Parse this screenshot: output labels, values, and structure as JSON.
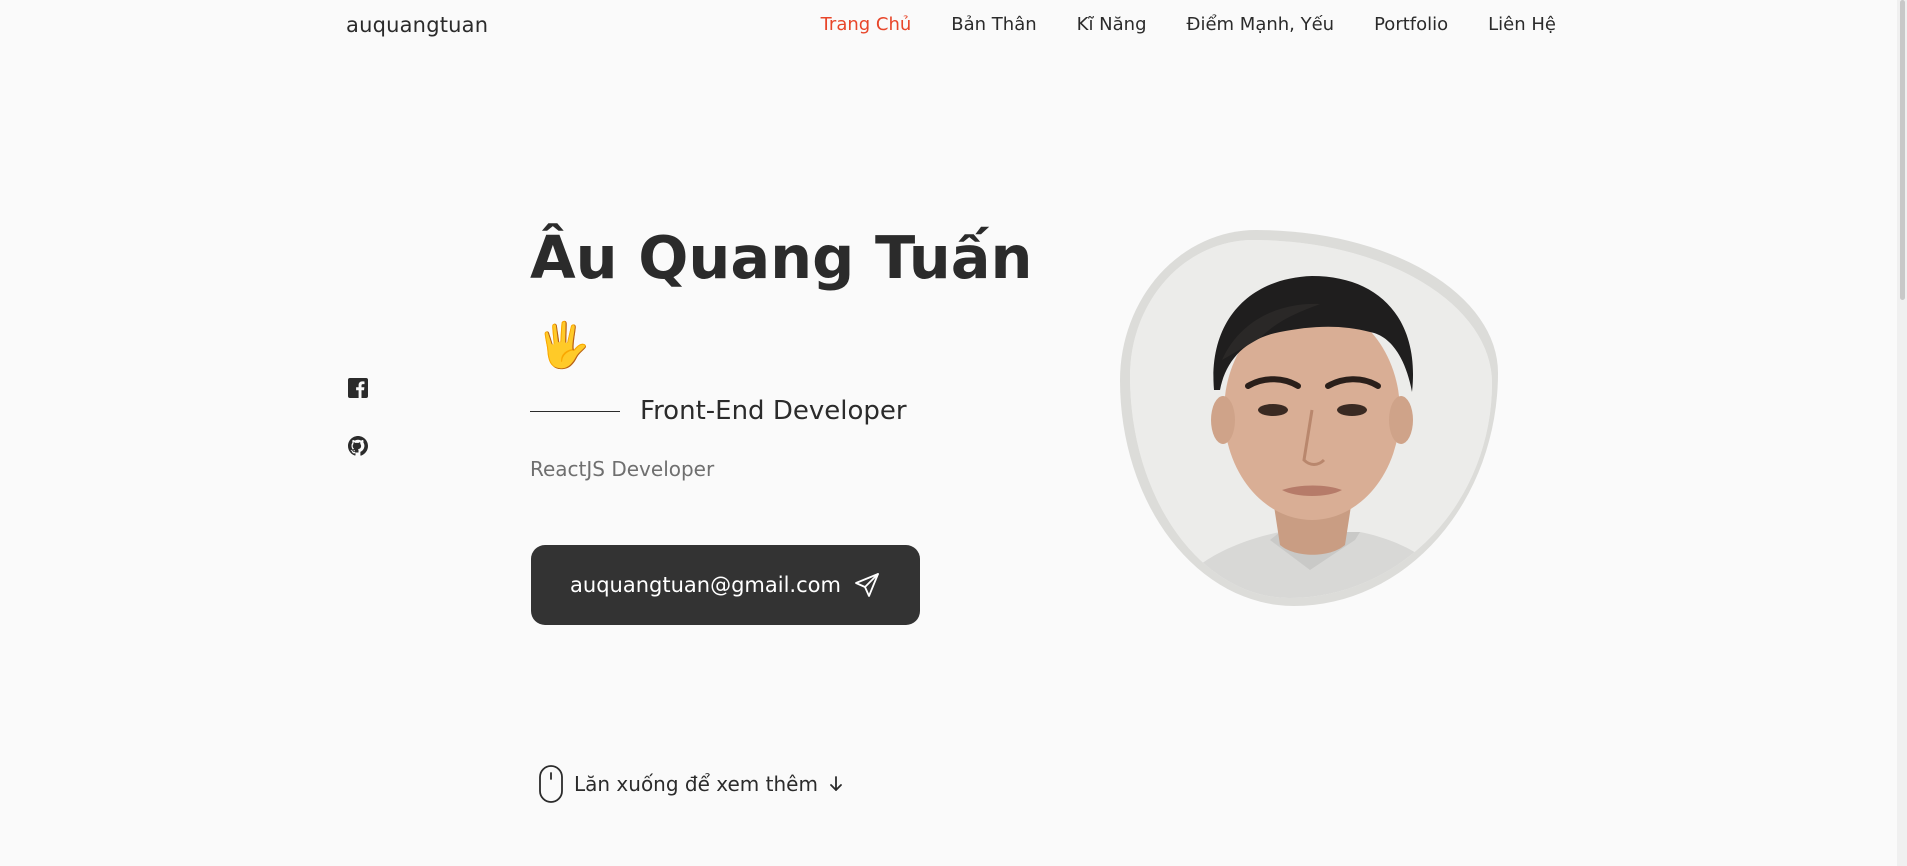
{
  "header": {
    "logo": "auquangtuan",
    "nav": [
      {
        "label": "Trang Chủ",
        "active": true
      },
      {
        "label": "Bản Thân",
        "active": false
      },
      {
        "label": "Kĩ Năng",
        "active": false
      },
      {
        "label": "Điểm Mạnh, Yếu",
        "active": false
      },
      {
        "label": "Portfolio",
        "active": false
      },
      {
        "label": "Liên Hệ",
        "active": false
      }
    ]
  },
  "social": [
    {
      "icon": "facebook-icon"
    },
    {
      "icon": "github-icon"
    }
  ],
  "hero": {
    "name": "Âu Quang Tuấn",
    "wave": "🖐",
    "title": "Front-End Developer",
    "description": "ReactJS Developer",
    "email": "auquangtuan@gmail.com",
    "email_icon": "send-icon"
  },
  "scroll_hint": {
    "label": "Lăn xuống để xem thêm",
    "mouse_icon": "mouse-icon",
    "arrow_icon": "arrow-down-icon"
  },
  "colors": {
    "accent": "#e8462a",
    "text": "#2b2b2b",
    "muted": "#6f6f6f",
    "button": "#333333",
    "background": "#fafafa"
  }
}
